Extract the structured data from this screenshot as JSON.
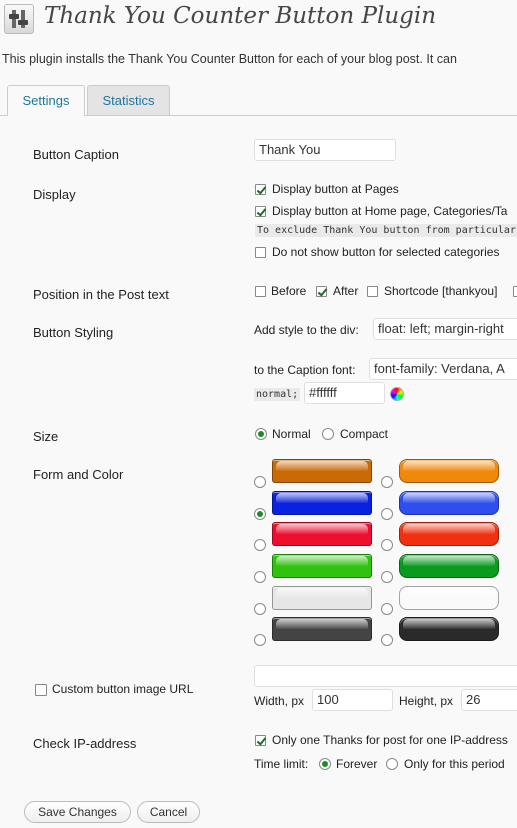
{
  "header": {
    "title": "Thank You Counter Button Plugin",
    "intro": "This plugin installs the Thank You Counter Button for each of your blog post. It can"
  },
  "tabs": [
    {
      "label": "Settings",
      "active": true
    },
    {
      "label": "Statistics",
      "active": false
    }
  ],
  "settings": {
    "button_caption": {
      "label": "Button Caption",
      "value": "Thank You"
    },
    "display": {
      "label": "Display",
      "pages": {
        "label": "Display button at Pages",
        "checked": true
      },
      "home": {
        "label": "Display button at Home page, Categories/Ta",
        "checked": true
      },
      "exclude_note": "To exclude Thank You button from particular",
      "no_categories": {
        "label": "Do not show button for selected categories",
        "checked": false
      }
    },
    "position": {
      "label": "Position in the Post text",
      "before": {
        "label": "Before",
        "checked": false
      },
      "after": {
        "label": "After",
        "checked": true
      },
      "shortcode": {
        "label": "Shortcode [thankyou]",
        "checked": false
      }
    },
    "styling": {
      "label": "Button Styling",
      "div_label": "Add style to the div:",
      "div_value": "float: left; margin-right",
      "caption_label": "to the Caption font:",
      "caption_value": "font-family: Verdana, A",
      "caption_tail": "normal;",
      "color_value": "#ffffff"
    },
    "size": {
      "label": "Size",
      "options": [
        {
          "label": "Normal",
          "checked": true
        },
        {
          "label": "Compact",
          "checked": false
        }
      ]
    },
    "form_color": {
      "label": "Form and Color",
      "selected_index": 2,
      "swatches": [
        {
          "color": "#c96a05",
          "style": "flat"
        },
        {
          "color": "#f0890a",
          "style": "glossy"
        },
        {
          "color": "#0a22e0",
          "style": "flat"
        },
        {
          "color": "#2f4ef0",
          "style": "glossy"
        },
        {
          "color": "#ee0f2e",
          "style": "flat"
        },
        {
          "color": "#f03010",
          "style": "glossy"
        },
        {
          "color": "#2fc20e",
          "style": "flat"
        },
        {
          "color": "#0a9a1e",
          "style": "glossy"
        },
        {
          "color": "#e6e6e6",
          "style": "flat"
        },
        {
          "color": "#fafafa",
          "style": "glossy"
        },
        {
          "color": "#444444",
          "style": "flat"
        },
        {
          "color": "#2a2a2a",
          "style": "glossy"
        }
      ]
    },
    "custom_image": {
      "label": "Custom button image URL",
      "checked": false,
      "url": "",
      "width_label": "Width, px",
      "width_value": "100",
      "height_label": "Height, px",
      "height_value": "26"
    },
    "ip_check": {
      "label": "Check IP-address",
      "only_one": {
        "label": "Only one Thanks for post for one IP-address",
        "checked": true
      },
      "time_limit_label": "Time limit:",
      "forever": {
        "label": "Forever",
        "checked": true
      },
      "period": {
        "label": "Only for this period",
        "checked": false
      }
    }
  },
  "footer": {
    "save_label": "Save Changes",
    "cancel_label": "Cancel"
  }
}
